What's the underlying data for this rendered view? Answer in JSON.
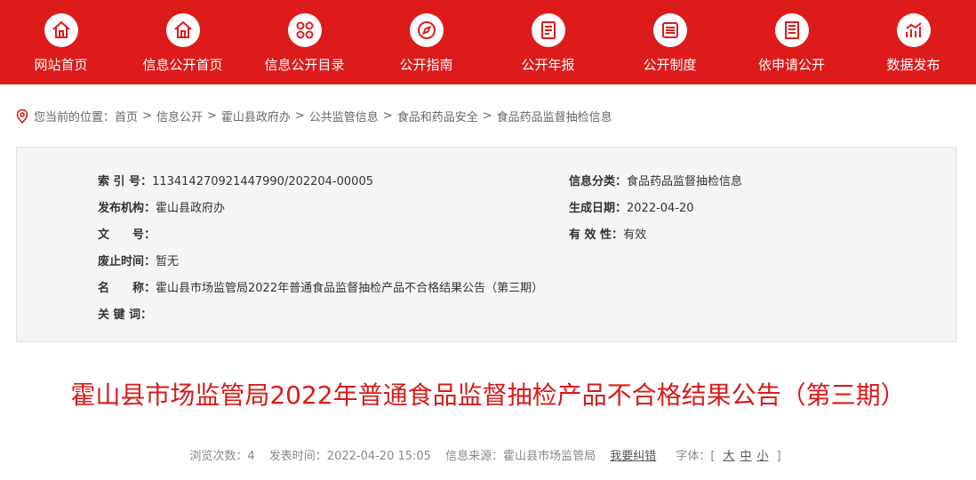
{
  "nav": [
    {
      "label": "网站首页",
      "icon": "home-icon"
    },
    {
      "label": "信息公开首页",
      "icon": "home-icon"
    },
    {
      "label": "信息公开目录",
      "icon": "grid-icon"
    },
    {
      "label": "公开指南",
      "icon": "compass-icon"
    },
    {
      "label": "公开年报",
      "icon": "report-icon"
    },
    {
      "label": "公开制度",
      "icon": "list-icon"
    },
    {
      "label": "依申请公开",
      "icon": "document-icon"
    },
    {
      "label": "数据发布",
      "icon": "chart-icon"
    }
  ],
  "breadcrumb": {
    "prefix": "您当前的位置：",
    "items": [
      "首页",
      "信息公开",
      "霍山县政府办",
      "公共监管信息",
      "食品和药品安全",
      "食品药品监督抽检信息"
    ],
    "separator": ">"
  },
  "meta": {
    "index_label": "索 引 号：",
    "index_value": "11341427092144799​0/202204-00005",
    "category_label": "信息分类：",
    "category_value": "食品药品监督抽检信息",
    "publisher_label": "发布机构：",
    "publisher_value": "霍山县政府办",
    "date_label": "生成日期：",
    "date_value": "2022-04-20",
    "docno_label": "文　　号：",
    "docno_value": "",
    "validity_label": "有 效 性：",
    "validity_value": "有效",
    "expiry_label": "废止时间：",
    "expiry_value": "暂无",
    "name_label": "名　　称：",
    "name_value": "霍山县市场监管局2022年普通食品监督抽检产品不合格结果公告（第三期）",
    "keywords_label": "关 键 词：",
    "keywords_value": ""
  },
  "article": {
    "title": "霍山县市场监管局2022年普通食品监督抽检产品不合格结果公告（第三期）",
    "views": "浏览次数：4",
    "published": "发表时间：2022-04-20 15:05",
    "source": "信息来源：霍山县市场监管局",
    "report_link": "我要纠错",
    "font_label": "字体：[",
    "font_large": "大",
    "font_medium": "中",
    "font_small": "小",
    "font_end": "]"
  },
  "colors": {
    "brand": "#dd1b1b",
    "title": "#d91a1a"
  }
}
